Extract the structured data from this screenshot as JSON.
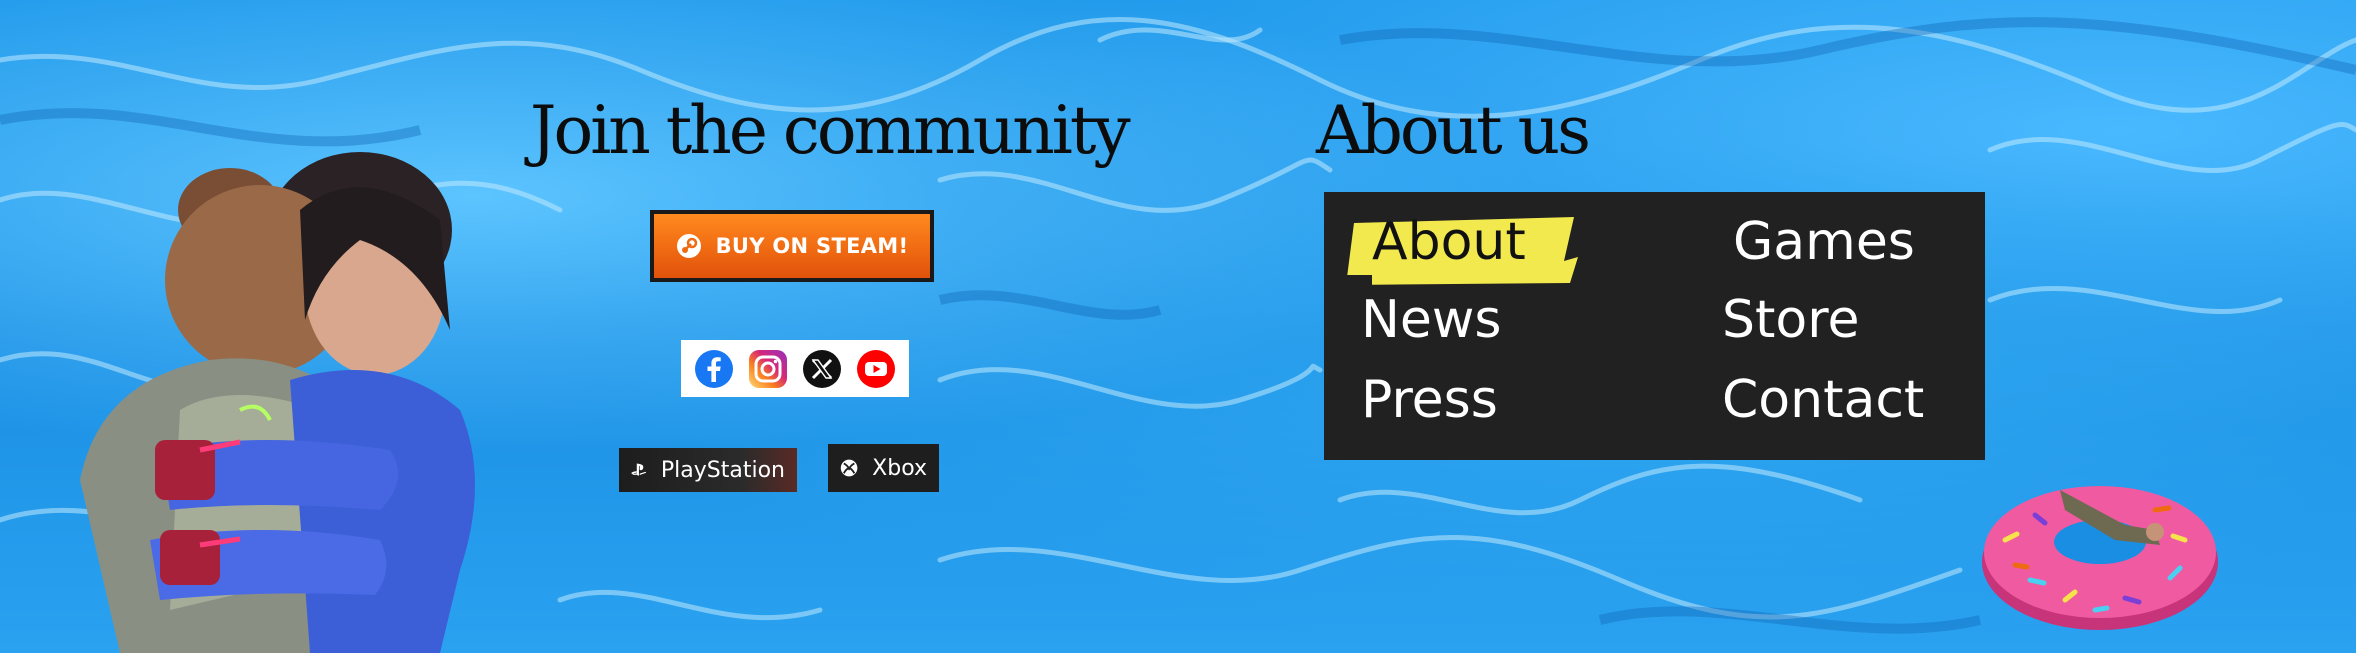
{
  "community": {
    "heading": "Join the community",
    "steam_button": "BUY ON STEAM!",
    "social_icons": [
      "facebook-icon",
      "instagram-icon",
      "x-icon",
      "youtube-icon"
    ],
    "platforms": {
      "playstation": "PlayStation",
      "xbox": "Xbox"
    }
  },
  "about": {
    "heading": "About us",
    "menu": {
      "about": "About",
      "games": "Games",
      "news": "News",
      "store": "Store",
      "press": "Press",
      "contact": "Contact"
    }
  },
  "colors": {
    "water": "#1e98ea",
    "steam_orange": "#f06a12",
    "menu_bg": "#212121",
    "highlight_yellow": "#f2e94e"
  }
}
